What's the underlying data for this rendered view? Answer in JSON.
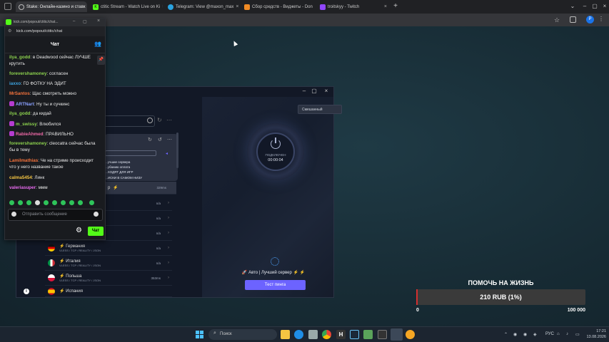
{
  "browser": {
    "tabs": [
      {
        "label": "Stake: Онлайн-казино и ставк"
      },
      {
        "label": "ctitic Stream - Watch Live on Ki"
      },
      {
        "label": "Telegram: View @maxon_max"
      },
      {
        "label": "Сбор средств - Виджеты - Don"
      },
      {
        "label": "troitskyy - Twitch"
      }
    ],
    "new_tab": "+"
  },
  "chat_popup": {
    "url": "kick.com/popout/ctitic/chat",
    "title_short": "kick.com/popout/ctitic/chat...",
    "header": "Чат",
    "messages": [
      {
        "user": "ilya_godd",
        "color": "#8cd14e",
        "text": ": в Deadwood сейчас ЛУЧШЕ крутить",
        "badge": false
      },
      {
        "user": "forevershamoney",
        "color": "#8cd14e",
        "text": ": согласен",
        "badge": false
      },
      {
        "user": "iaxxo",
        "color": "#3ea6e3",
        "text": ": ГО ФОТКУ НА ЭДИТ",
        "badge": false
      },
      {
        "user": "MrSantos",
        "color": "#f5733c",
        "text": ": Щас смотреть можно",
        "badge": false
      },
      {
        "user": "ARTNart",
        "color": "#8aa0ff",
        "text": ": Ну ты и сучкинс",
        "badge": true
      },
      {
        "user": "ilya_godd",
        "color": "#8cd14e",
        "text": ": да кидай",
        "badge": false
      },
      {
        "user": "m_swissy",
        "color": "#8cd14e",
        "text": ": Влюбился",
        "badge": true
      },
      {
        "user": "RabieAhmed",
        "color": "#f06aa8",
        "text": ": ПРАВИЛЬНО",
        "badge": true
      },
      {
        "user": "forevershamoney",
        "color": "#8cd14e",
        "text": ": cleocatra сейчас была бы в тему",
        "badge": false
      },
      {
        "user": "Lamilmathias",
        "color": "#f5733c",
        "text": ": Че на стриме происходит что у него название такое",
        "badge": false
      },
      {
        "user": "calma5454",
        "color": "#f5c542",
        "text": ": Линк",
        "badge": false
      },
      {
        "user": "valeriasuper",
        "color": "#e86bf0",
        "text": ": ммм",
        "badge": false
      }
    ],
    "input_placeholder": "Отправить сообщение",
    "send_label": "Чат"
  },
  "vpn": {
    "mode_select": "Смешанный",
    "status": "ПОДКЛЮЧЕН",
    "timer": "00:00:04",
    "best_server": "Авто | Лучший сервер",
    "ping_button": "Тест пинга",
    "popup_lines": [
      "...учшие сервера",
      "...убанию оплата",
      "...ХОДЯТ ДЛЯ ИГР",
      "...ИСКИ В САМОМ НИЗУ"
    ],
    "popup_row": "p",
    "popup_latency": "329ms",
    "servers": [
      {
        "name": "",
        "sub": "",
        "latency": "n/a",
        "flag": "#555"
      },
      {
        "name": "",
        "sub": "",
        "latency": "n/a",
        "flag": "#555"
      },
      {
        "name": "",
        "sub": "",
        "latency": "n/a",
        "flag": "#555"
      },
      {
        "name": "Германия",
        "sub": "VLESS / TCP / REALITY / JSON",
        "latency": "n/a",
        "flag": "#c0392b"
      },
      {
        "name": "Италия",
        "sub": "VLESS / TCP / REALITY / JSON",
        "latency": "n/a",
        "flag": "#2e9e4f"
      },
      {
        "name": "Польша",
        "sub": "VLESS / TCP / REALITY / JSON",
        "latency": "353ms",
        "flag": "#d9d9d9"
      },
      {
        "name": "Испания",
        "sub": "",
        "latency": "",
        "flag": "#e0a800"
      }
    ]
  },
  "donation": {
    "title": "ПОМОЧЬ НА ЖИЗНЬ",
    "amount": "210 RUB (1%)",
    "min": "0",
    "max": "100 000",
    "progress": 0.01
  },
  "taskbar": {
    "search": "Поиск",
    "lang": "РУС",
    "time": "17:21",
    "date": "13.08.2026"
  },
  "colors": {
    "kick_green": "#53fc18",
    "vpn_button": "#6c63ff",
    "page_bg": "#172b34"
  }
}
